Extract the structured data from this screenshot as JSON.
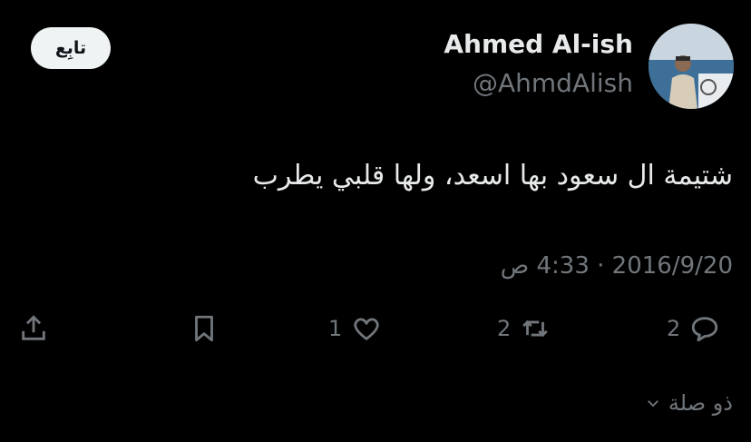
{
  "header": {
    "follow_label": "تابِع",
    "display_name": "Ahmed Al-ish",
    "handle": "@AhmdAlish"
  },
  "tweet": {
    "text": "شتيمة ال سعود بها اسعد، ولها قلبي يطرب",
    "date": "2016/9/20",
    "separator": "·",
    "time": "4:33 ص"
  },
  "actions": {
    "replies": "2",
    "retweets": "2",
    "likes": "1",
    "reply_icon": "reply-icon",
    "retweet_icon": "retweet-icon",
    "like_icon": "heart-icon",
    "bookmark_icon": "bookmark-icon",
    "share_icon": "share-icon"
  },
  "footer": {
    "thread_label": "ذو صلة"
  }
}
